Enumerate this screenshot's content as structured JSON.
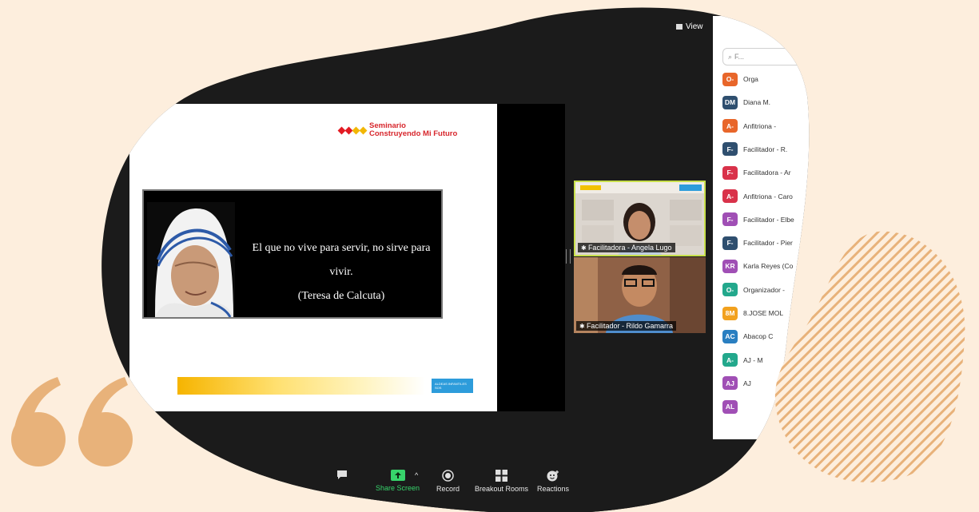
{
  "view_button": {
    "label": "View"
  },
  "slide": {
    "logo_line1": "Seminario",
    "logo_line2": "Construyendo Mi Futuro",
    "quote_line1": "El que no vive para servir, no sirve para vivir.",
    "quote_line2": "(Teresa de Calcuta)",
    "badge_text": "ALDEAS INFANTILES SOS"
  },
  "video_tiles": [
    {
      "name": "Facilitadora - Angela Lugo",
      "header_badge": "DHL"
    },
    {
      "name": "Facilitador - Rildo Gamarra"
    }
  ],
  "participants": {
    "search_placeholder": "F...",
    "items": [
      {
        "initials": "O-",
        "name": "Orga",
        "color": "#e8662a"
      },
      {
        "initials": "DM",
        "name": "Diana M.",
        "color": "#2f4f6f"
      },
      {
        "initials": "A-",
        "name": "Anfitriona -",
        "color": "#e8662a"
      },
      {
        "initials": "F-",
        "name": "Facilitador - R.",
        "color": "#2f4f6f"
      },
      {
        "initials": "F-",
        "name": "Facilitadora - Ar",
        "color": "#d9324a"
      },
      {
        "initials": "A-",
        "name": "Anfitriona - Caro",
        "color": "#d9324a"
      },
      {
        "initials": "F-",
        "name": "Facilitador - Elbe",
        "color": "#a04fb5"
      },
      {
        "initials": "F-",
        "name": "Facilitador - Pier",
        "color": "#2f4f6f"
      },
      {
        "initials": "KR",
        "name": "Karla Reyes (Co",
        "color": "#a04fb5"
      },
      {
        "initials": "O-",
        "name": "Organizador -",
        "color": "#23a88c"
      },
      {
        "initials": "8M",
        "name": "8.JOSE MOL",
        "color": "#f2a11e"
      },
      {
        "initials": "AC",
        "name": "Abacop C",
        "color": "#2a7fc1"
      },
      {
        "initials": "A-",
        "name": "AJ - M",
        "color": "#23a88c"
      },
      {
        "initials": "AJ",
        "name": "AJ",
        "color": "#a04fb5"
      },
      {
        "initials": "AL",
        "name": "",
        "color": "#a04fb5"
      }
    ]
  },
  "toolbar": {
    "share_label": "Share Screen",
    "record_label": "Record",
    "breakout_label": "Breakout Rooms",
    "reactions_label": "Reactions"
  },
  "colors": {
    "page_bg": "#fdeedd",
    "accent_orange": "#e8b27a",
    "share_green": "#37d46b"
  }
}
